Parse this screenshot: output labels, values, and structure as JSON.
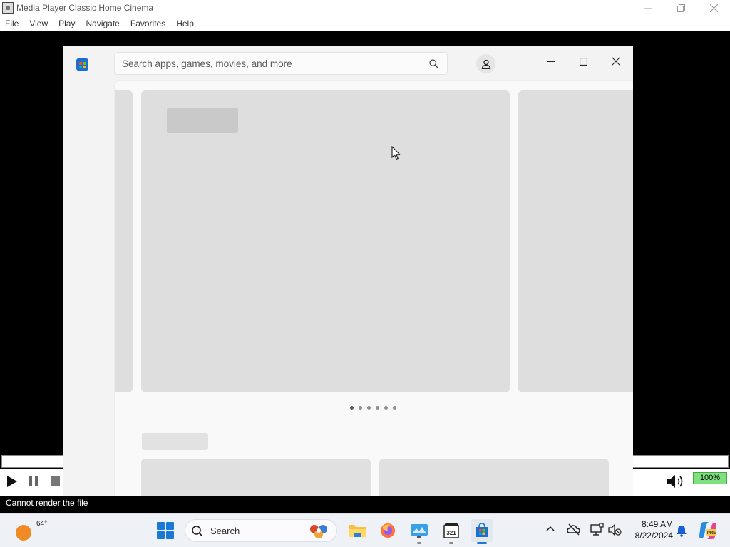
{
  "mpc": {
    "title": "Media Player Classic Home Cinema",
    "menu": [
      "File",
      "View",
      "Play",
      "Navigate",
      "Favorites",
      "Help"
    ],
    "volume": "100%",
    "status": "Cannot render the file"
  },
  "store": {
    "search_placeholder": "Search apps, games, movies, and more",
    "carousel_dots": 6,
    "active_dot": 0
  },
  "taskbar": {
    "weather_temp": "64°",
    "search_label": "Search",
    "time": "8:49 AM",
    "date": "8/22/2024",
    "apps": [
      {
        "name": "File Explorer"
      },
      {
        "name": "Firefox"
      },
      {
        "name": "Remote Desktop"
      },
      {
        "name": "Media Player Classic"
      },
      {
        "name": "Microsoft Store",
        "active": true
      }
    ]
  },
  "colors": {
    "accent": "#1b79d6",
    "volume_bar": "#7fe07f",
    "skeleton": "#dedede"
  }
}
